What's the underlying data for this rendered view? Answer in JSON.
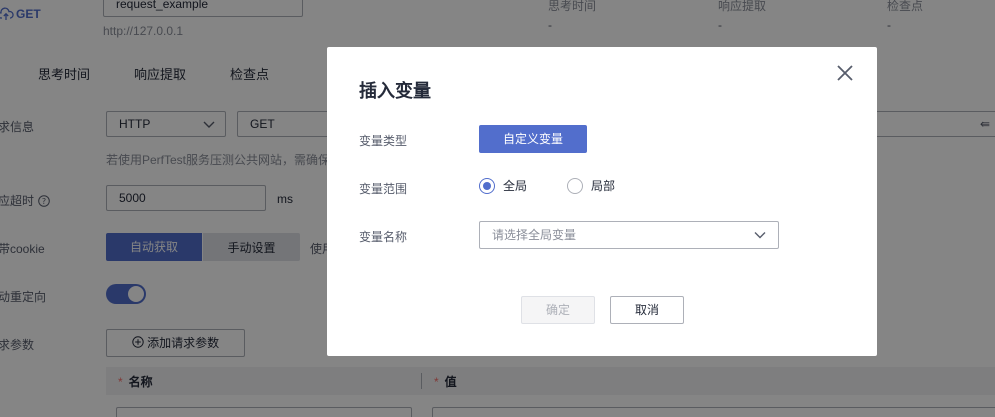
{
  "header": {
    "method": "GET",
    "request_name": "request_example",
    "url": "http://127.0.0.1",
    "stats": [
      {
        "label": "思考时间",
        "value": "-"
      },
      {
        "label": "响应提取",
        "value": "-"
      },
      {
        "label": "检查点",
        "value": "-"
      }
    ]
  },
  "tabs": [
    "思考时间",
    "响应提取",
    "检查点"
  ],
  "form": {
    "request_info_label": "求信息",
    "protocol": "HTTP",
    "method": "GET",
    "hint": "若使用PerfTest服务压测公共网站，需确保",
    "timeout_label": "应超时",
    "timeout_value": "5000",
    "timeout_unit": "ms",
    "cookie_label": "带cookie",
    "cookie_auto": "自动获取",
    "cookie_manual": "手动设置",
    "cookie_hint": "使用",
    "redirect_label": "动重定向",
    "params_label": "求参数",
    "add_param": "添加请求参数",
    "col_name": "名称",
    "col_value": "值",
    "required_mark": "*"
  },
  "modal": {
    "title": "插入变量",
    "type_label": "变量类型",
    "type_value": "自定义变量",
    "scope_label": "变量范围",
    "scope_options": [
      "全局",
      "局部"
    ],
    "scope_selected": "全局",
    "name_label": "变量名称",
    "name_placeholder": "请选择全局变量",
    "ok": "确定",
    "cancel": "取消"
  },
  "colors": {
    "primary": "#526ecc",
    "overlay": "rgba(0,0,0,0.48)"
  }
}
